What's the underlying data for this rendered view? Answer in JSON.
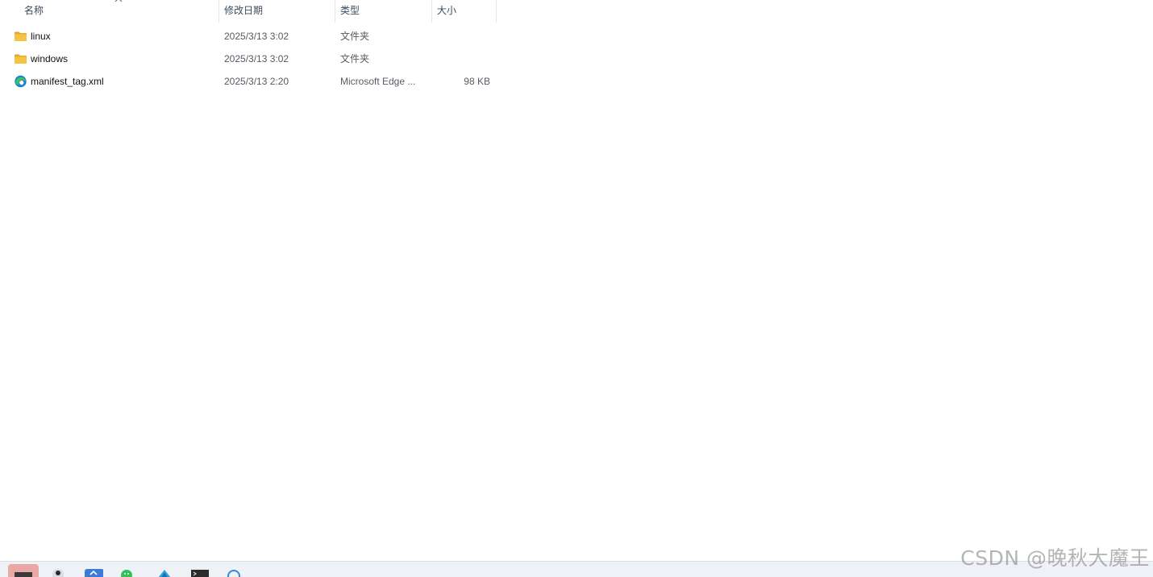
{
  "columns": {
    "name": "名称",
    "date": "修改日期",
    "type": "类型",
    "size": "大小"
  },
  "sort": {
    "column": "name",
    "direction": "ascending"
  },
  "files": [
    {
      "name": "linux",
      "date": "2025/3/13 3:02",
      "type": "文件夹",
      "size": "",
      "icon": "folder-icon"
    },
    {
      "name": "windows",
      "date": "2025/3/13 3:02",
      "type": "文件夹",
      "size": "",
      "icon": "folder-icon"
    },
    {
      "name": "manifest_tag.xml",
      "date": "2025/3/13 2:20",
      "type": "Microsoft Edge ...",
      "size": "98 KB",
      "icon": "edge-icon"
    }
  ],
  "taskbar": {
    "items": [
      "terminal-app-icon",
      "avatar-app-icon",
      "blue-app-icon",
      "wechat-icon",
      "vscode-icon",
      "console-icon",
      "browser-icon"
    ]
  },
  "watermark": "CSDN @晚秋大魔王",
  "colors": {
    "folder": "#f5c342",
    "folder_dark": "#e2a92a",
    "edge_blue": "#1b7fd6",
    "edge_green": "#3fbf6a",
    "header_text": "#3b4a5e"
  }
}
